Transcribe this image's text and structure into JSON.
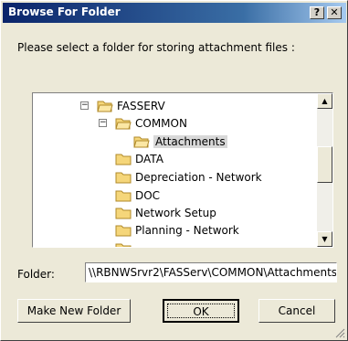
{
  "window": {
    "title": "Browse For Folder",
    "help_glyph": "?",
    "close_glyph": "✕"
  },
  "prompt": "Please select a folder for storing attachment files :",
  "tree": {
    "items": [
      {
        "label": "FASSERV",
        "expander": "⊟",
        "icon": "open-folder-icon"
      },
      {
        "label": "COMMON",
        "expander": "⊟",
        "icon": "open-folder-icon"
      },
      {
        "label": "Attachments",
        "icon": "open-folder-icon",
        "selected": true
      },
      {
        "label": "DATA",
        "icon": "folder-icon"
      },
      {
        "label": "Depreciation - Network",
        "icon": "folder-icon"
      },
      {
        "label": "DOC",
        "icon": "folder-icon"
      },
      {
        "label": "Network Setup",
        "icon": "folder-icon"
      },
      {
        "label": "Planning - Network",
        "icon": "folder-icon"
      }
    ]
  },
  "folder": {
    "label": "Folder:",
    "value": "\\\\RBNWSrvr2\\FASServ\\COMMON\\Attachments"
  },
  "buttons": {
    "new_folder": "Make New Folder",
    "ok": "OK",
    "cancel": "Cancel"
  },
  "colors": {
    "titlebar_start": "#0a246a",
    "titlebar_end": "#a6caf0",
    "folder_fill": "#f5d67a",
    "dialog_bg": "#ece9d8"
  }
}
